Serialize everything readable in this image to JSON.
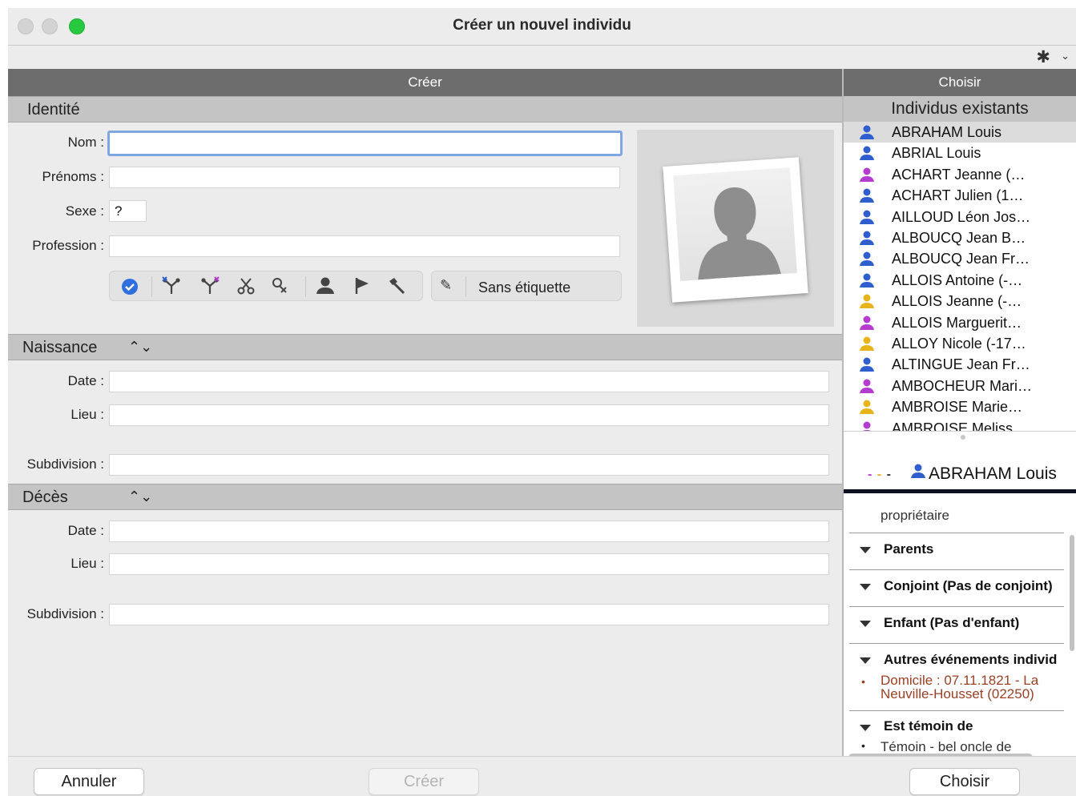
{
  "window": {
    "title": "Créer un nouvel individu"
  },
  "toolbar": {
    "gear_icon": "gear-icon",
    "chevron_icon": "chevron-down-icon"
  },
  "left": {
    "header": "Créer",
    "identity": {
      "section_title": "Identité",
      "nom_label": "Nom :",
      "nom_value": "",
      "prenoms_label": "Prénoms :",
      "prenoms_value": "",
      "sexe_label": "Sexe :",
      "sexe_value": "?",
      "profession_label": "Profession :",
      "profession_value": "",
      "tag_label": "Sans étiquette",
      "tool_icons": [
        "check-circle-icon",
        "tree-blue-x-icon",
        "tree-purple-x-icon",
        "scissors-icon",
        "unlink-icon",
        "person-icon",
        "flag-icon",
        "gavel-icon"
      ]
    },
    "naissance": {
      "section_title": "Naissance",
      "date_label": "Date :",
      "lieu_label": "Lieu :",
      "subdivision_label": "Subdivision :"
    },
    "deces": {
      "section_title": "Décès",
      "date_label": "Date :",
      "lieu_label": "Lieu :",
      "subdivision_label": "Subdivision :"
    }
  },
  "right": {
    "header": "Choisir",
    "sub_header": "Individus existants",
    "colors": {
      "male": "#2f5fcf",
      "female": "#b63ccf",
      "unknown": "#e8b41c"
    },
    "individuals": [
      {
        "name": "ABRAHAM Louis",
        "sex": "male",
        "selected": true
      },
      {
        "name": "ABRIAL Louis",
        "sex": "male"
      },
      {
        "name": "ACHART Jeanne (…",
        "sex": "female"
      },
      {
        "name": "ACHART Julien (1…",
        "sex": "male"
      },
      {
        "name": "AILLOUD Léon Jos…",
        "sex": "male"
      },
      {
        "name": "ALBOUCQ Jean B…",
        "sex": "male"
      },
      {
        "name": "ALBOUCQ Jean Fr…",
        "sex": "male"
      },
      {
        "name": "ALLOIS Antoine (-…",
        "sex": "male"
      },
      {
        "name": "ALLOIS Jeanne (-…",
        "sex": "unknown"
      },
      {
        "name": "ALLOIS Marguerit…",
        "sex": "female"
      },
      {
        "name": "ALLOY Nicole (-17…",
        "sex": "unknown"
      },
      {
        "name": "ALTINGUE Jean Fr…",
        "sex": "male"
      },
      {
        "name": "AMBOCHEUR Mari…",
        "sex": "female"
      },
      {
        "name": "AMBROISE Marie…",
        "sex": "unknown"
      },
      {
        "name": "AMBROISE Meliss…",
        "sex": "female"
      }
    ],
    "detail": {
      "name": "ABRAHAM Louis",
      "owner": "propriétaire",
      "parents": "Parents",
      "conjoint": "Conjoint (Pas de conjoint)",
      "enfant": "Enfant (Pas d'enfant)",
      "autres": "Autres événements individ",
      "domicile": "Domicile : 07.11.1821 - La Neuville-Housset (02250)",
      "temoin_title": "Est témoin de",
      "temoin_item": "Témoin - bel oncle de"
    }
  },
  "buttons": {
    "cancel": "Annuler",
    "create": "Créer",
    "choose": "Choisir"
  }
}
